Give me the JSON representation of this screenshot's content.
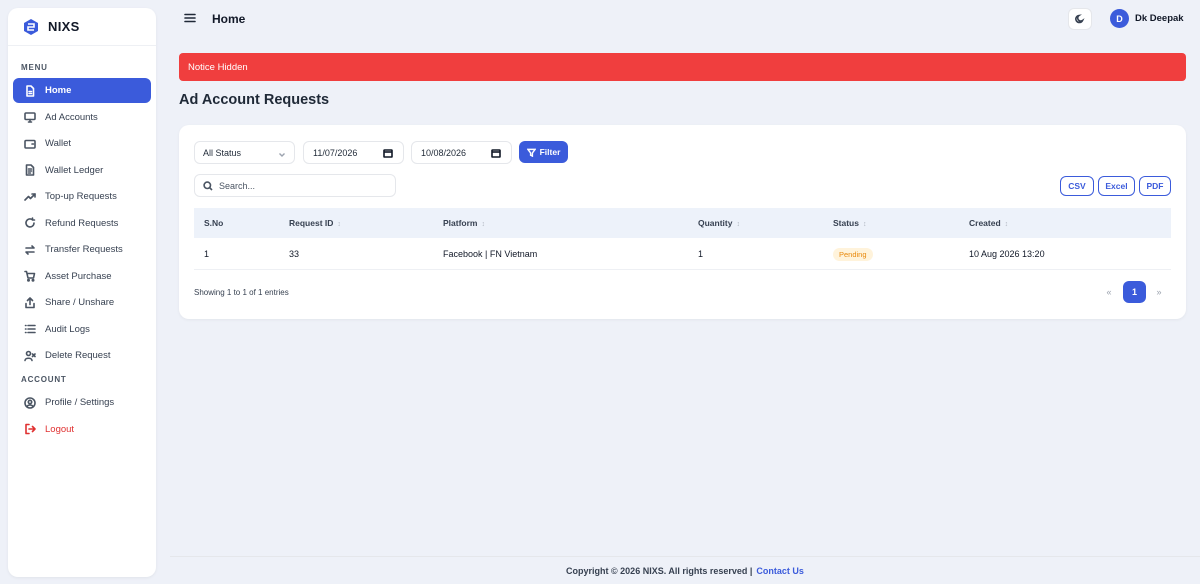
{
  "brand": {
    "name": "NIXS"
  },
  "sidebar": {
    "menu_label": "MENU",
    "items": [
      {
        "label": "Home",
        "icon": "file-icon"
      },
      {
        "label": "Ad Accounts",
        "icon": "monitor-icon"
      },
      {
        "label": "Wallet",
        "icon": "wallet-icon"
      },
      {
        "label": "Wallet Ledger",
        "icon": "document-icon"
      },
      {
        "label": "Top-up Requests",
        "icon": "trend-up-icon"
      },
      {
        "label": "Refund Requests",
        "icon": "refresh-icon"
      },
      {
        "label": "Transfer Requests",
        "icon": "transfer-icon"
      },
      {
        "label": "Asset Purchase",
        "icon": "cart-icon"
      },
      {
        "label": "Share / Unshare",
        "icon": "share-icon"
      },
      {
        "label": "Audit Logs",
        "icon": "list-icon"
      },
      {
        "label": "Delete Request",
        "icon": "user-delete-icon"
      }
    ],
    "account_label": "ACCOUNT",
    "account_items": [
      {
        "label": "Profile / Settings",
        "icon": "user-circle-icon"
      },
      {
        "label": "Logout",
        "icon": "logout-icon"
      }
    ]
  },
  "header": {
    "title": "Home",
    "user": {
      "initial": "D",
      "name": "Dk Deepak"
    }
  },
  "notice": {
    "text": "Notice Hidden"
  },
  "main": {
    "title": "Ad Account Requests",
    "filters": {
      "status": "All Status",
      "from_date": "11/07/2026",
      "to_date": "10/08/2026",
      "filter_label": "Filter"
    },
    "search": {
      "placeholder": "Search..."
    },
    "exports": {
      "csv": "CSV",
      "excel": "Excel",
      "pdf": "PDF"
    },
    "table": {
      "columns": [
        "S.No",
        "Request ID",
        "Platform",
        "Quantity",
        "Status",
        "Created"
      ],
      "rows": [
        {
          "sno": "1",
          "request_id": "33",
          "platform": "Facebook | FN Vietnam",
          "quantity": "1",
          "status": "Pending",
          "created": "10 Aug 2026 13:20"
        }
      ]
    },
    "showing": "Showing 1 to 1 of 1 entries",
    "pagination": {
      "prev": "«",
      "current": "1",
      "next": "»"
    }
  },
  "footer": {
    "copyright": "Copyright © 2026 NIXS. All rights reserved |",
    "contact": "Contact Us"
  },
  "colors": {
    "accent": "#3b5bdb",
    "notice": "#f03e3e",
    "pending": "#e8890c"
  }
}
